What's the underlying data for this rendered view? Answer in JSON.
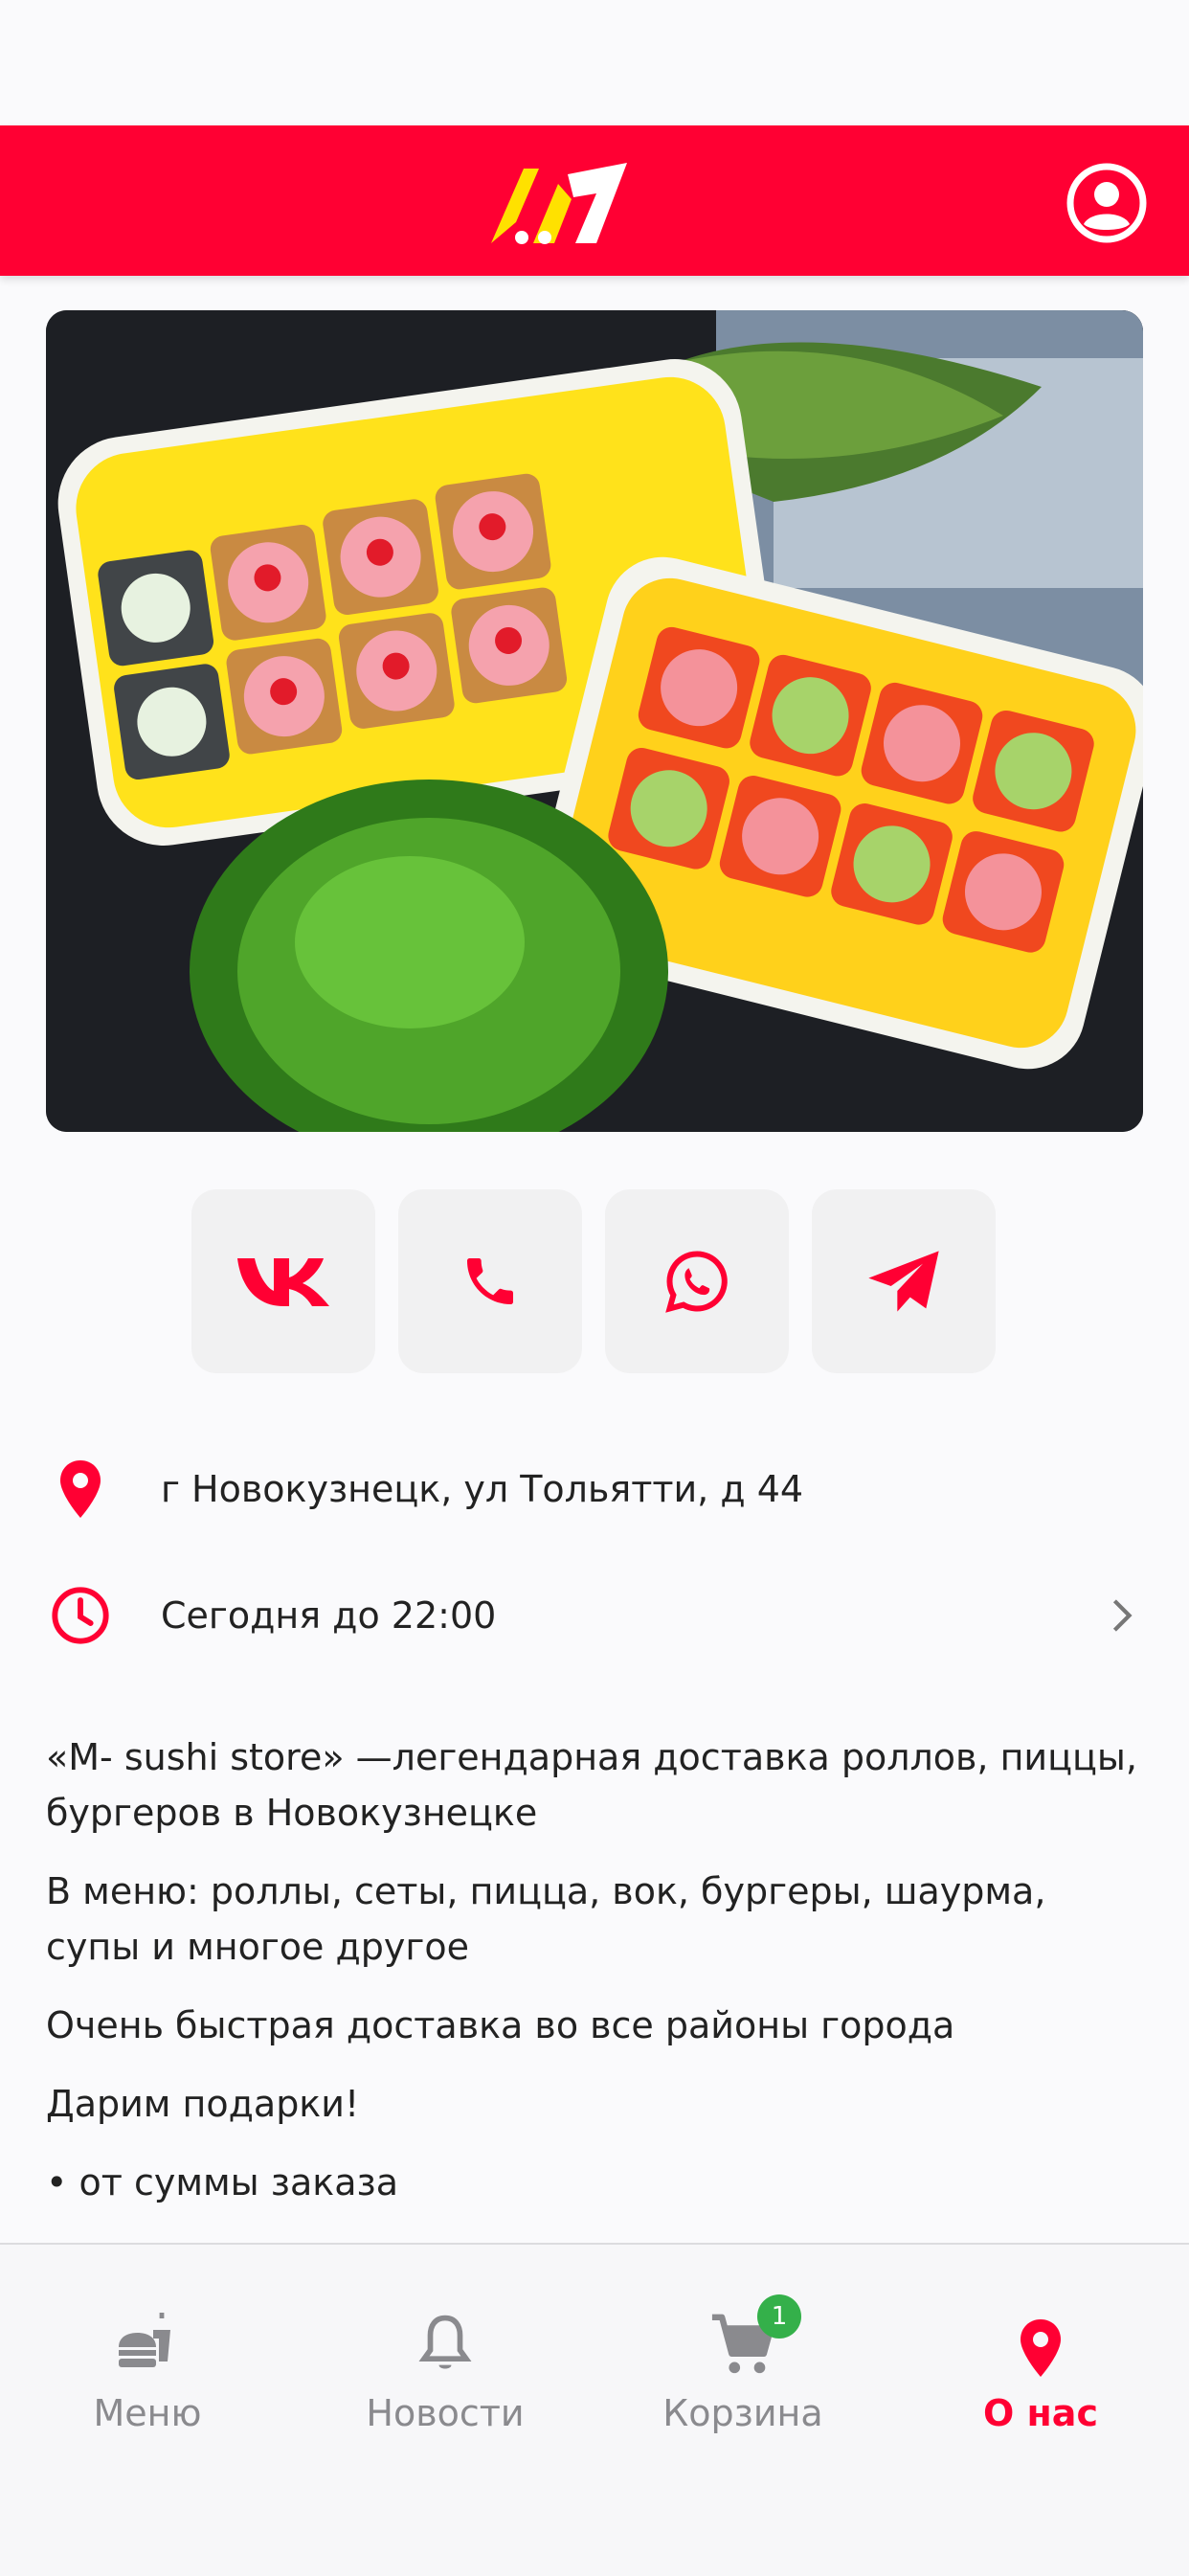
{
  "colors": {
    "accent": "#ff0033",
    "logo": "#ffe100",
    "badge": "#34b04a",
    "tab_inactive": "#8a8a8e"
  },
  "header": {
    "logo_icon": "brand-logo",
    "profile_icon": "profile-icon"
  },
  "hero": {
    "image": "sushi-rolls-photo"
  },
  "social": [
    {
      "icon": "vk-icon"
    },
    {
      "icon": "phone-icon"
    },
    {
      "icon": "whatsapp-icon"
    },
    {
      "icon": "telegram-icon"
    }
  ],
  "info": {
    "address": "г Новокузнецк, ул Тольятти, д 44",
    "hours": "Сегодня до 22:00"
  },
  "description": {
    "p1": "«M- sushi store» —легендарная доставка роллов, пиццы, бургеров в Новокузнецке",
    "p2": "В меню: роллы, сеты, пицца, вок, бургеры, шаурма, супы и многое другое",
    "p3": "Очень быстрая доставка во все районы города",
    "p4": "Дарим подарки!",
    "p5": "• от суммы заказа"
  },
  "tabbar": {
    "menu": "Меню",
    "news": "Новости",
    "cart": "Корзина",
    "cart_badge": "1",
    "about": "О нас",
    "active": "about"
  }
}
